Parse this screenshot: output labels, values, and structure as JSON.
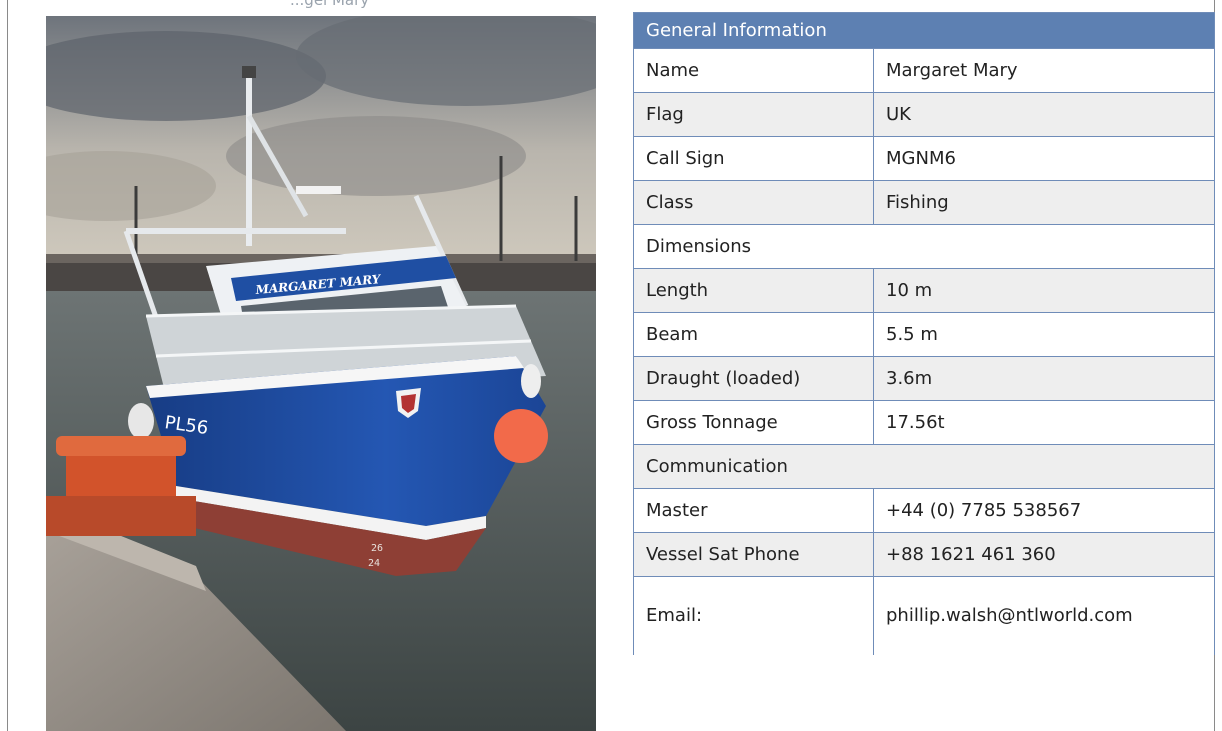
{
  "caption": "...gel Mary",
  "photo": {
    "hull_number": "PL56",
    "vessel_name_on_hull": "MARGARET MARY",
    "bow_marks": [
      "26",
      "24"
    ]
  },
  "table": {
    "header": "General Information",
    "rows": [
      {
        "label": "Name",
        "value": "Margaret Mary",
        "style": "plain"
      },
      {
        "label": "Flag",
        "value": "UK",
        "style": "alt"
      },
      {
        "label": "Call Sign",
        "value": "MGNM6",
        "style": "plain"
      },
      {
        "label": "Class",
        "value": "Fishing",
        "style": "alt"
      },
      {
        "section": "Dimensions"
      },
      {
        "label": "Length",
        "value": "10 m",
        "style": "alt"
      },
      {
        "label": "Beam",
        "value": "5.5 m",
        "style": "plain"
      },
      {
        "label": "Draught (loaded)",
        "value": "3.6m",
        "style": "alt"
      },
      {
        "label": "Gross Tonnage",
        "value": "17.56t",
        "style": "plain"
      },
      {
        "section": "Communication"
      },
      {
        "label": "Master",
        "value": "+44 (0) 7785 538567",
        "style": "plain"
      },
      {
        "label": "Vessel Sat Phone",
        "value": "+88 1621 461 360",
        "style": "alt"
      },
      {
        "label": "Email:",
        "value": "phillip.walsh@ntlworld.com",
        "style": "plain"
      }
    ]
  },
  "colors": {
    "header_bg": "#5d80b2",
    "border": "#6f8cb8",
    "alt_row": "#eeeeee",
    "hull_blue": "#1f4fa3"
  }
}
